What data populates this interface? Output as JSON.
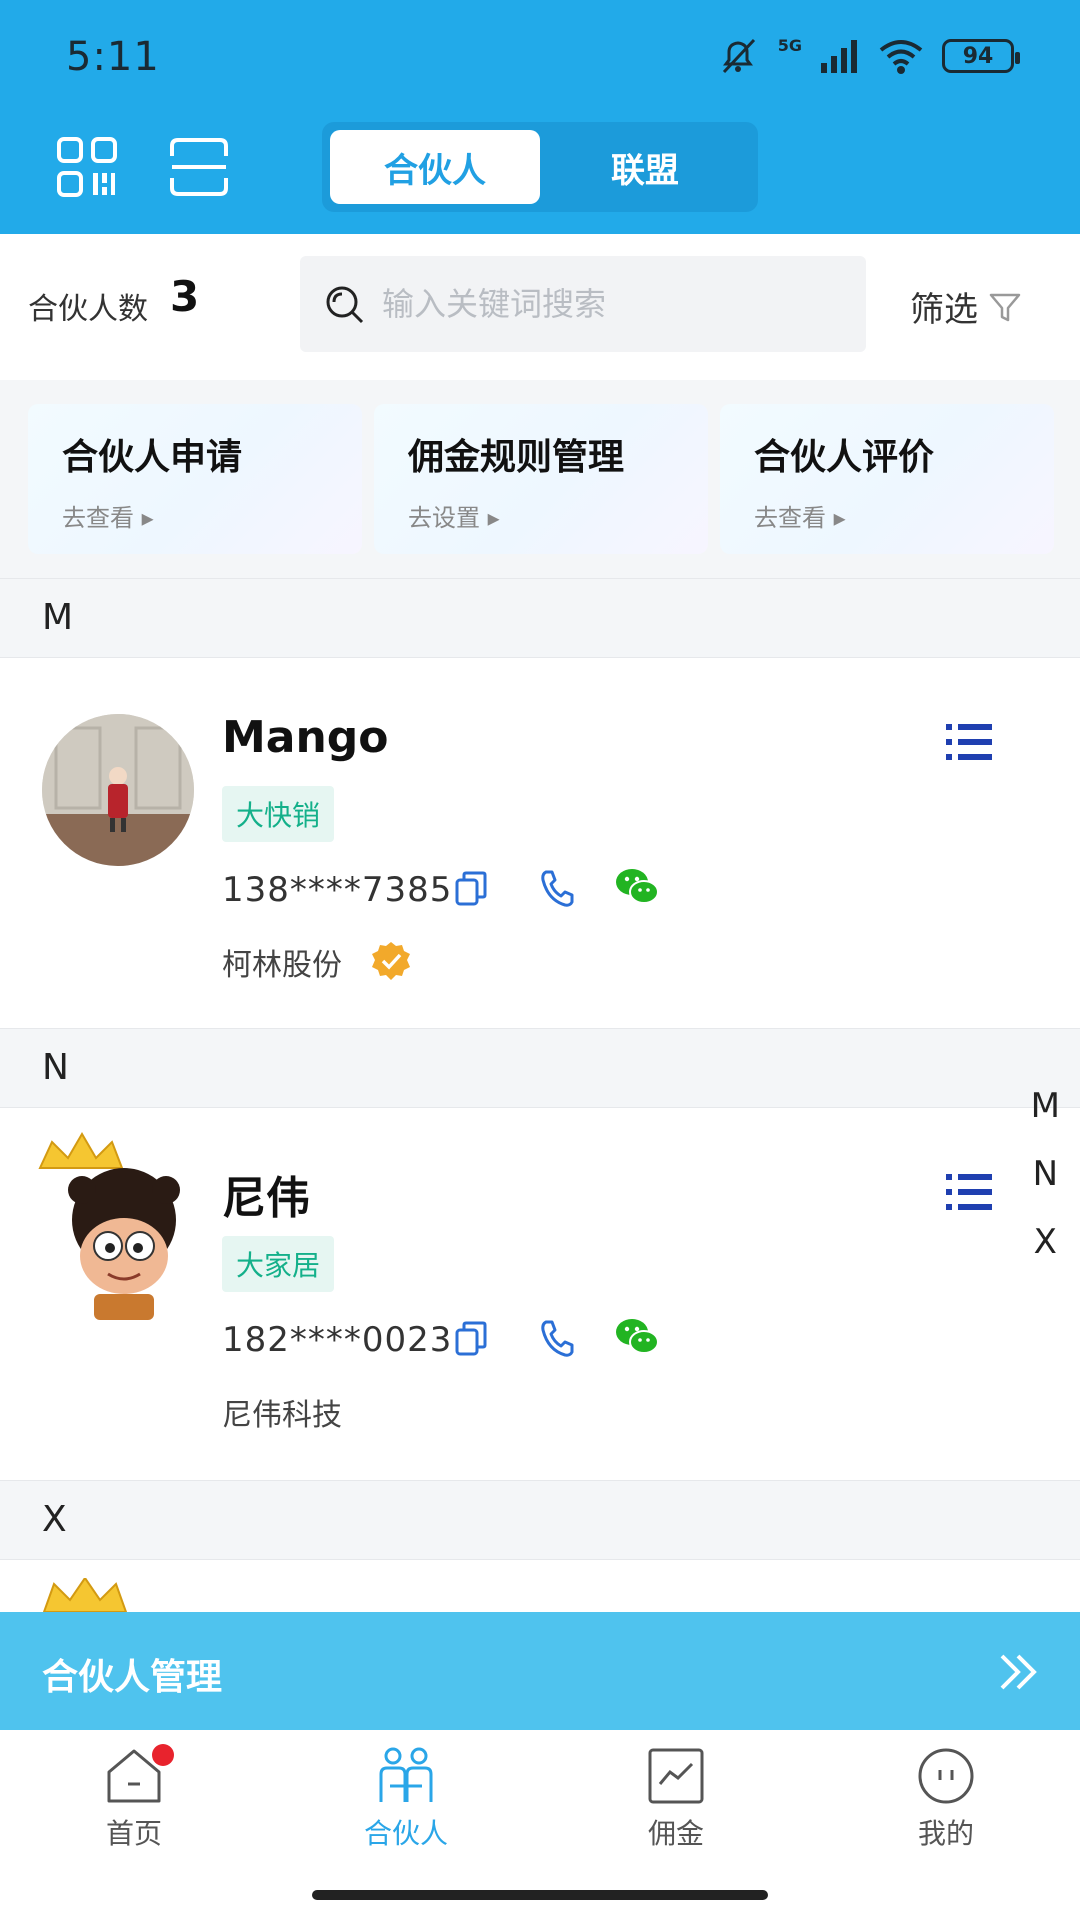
{
  "status": {
    "time": "5:11",
    "network": "5G",
    "battery": "94"
  },
  "header": {
    "tabs": [
      {
        "label": "合伙人",
        "active": true
      },
      {
        "label": "联盟",
        "active": false
      }
    ]
  },
  "search": {
    "count_label": "合伙人数",
    "count_value": "3",
    "placeholder": "输入关键词搜索",
    "filter_label": "筛选"
  },
  "quick_cards": [
    {
      "title": "合伙人申请",
      "action": "去查看 ▸"
    },
    {
      "title": "佣金规则管理",
      "action": "去设置 ▸"
    },
    {
      "title": "合伙人评价",
      "action": "去查看 ▸"
    }
  ],
  "sections": [
    {
      "letter": "M"
    },
    {
      "letter": "N"
    },
    {
      "letter": "X"
    }
  ],
  "partners": [
    {
      "name": "Mango",
      "tag": "大快销",
      "phone": "138****7385",
      "company": "柯林股份",
      "verified": true
    },
    {
      "name": "尼伟",
      "tag": "大家居",
      "phone": "182****0023",
      "company": "尼伟科技",
      "verified": false
    }
  ],
  "alphabet_index": [
    "M",
    "N",
    "X"
  ],
  "banner": {
    "label": "合伙人管理"
  },
  "tabbar": [
    {
      "label": "首页",
      "icon": "home-icon",
      "active": false,
      "badge": true
    },
    {
      "label": "合伙人",
      "icon": "partners-icon",
      "active": true
    },
    {
      "label": "佣金",
      "icon": "commission-icon",
      "active": false
    },
    {
      "label": "我的",
      "icon": "profile-icon",
      "active": false
    }
  ],
  "colors": {
    "primary": "#22aae9",
    "accent": "#2aa6e8",
    "tag": "#14b08a",
    "wechat": "#22b422",
    "badge": "#e8232d"
  }
}
